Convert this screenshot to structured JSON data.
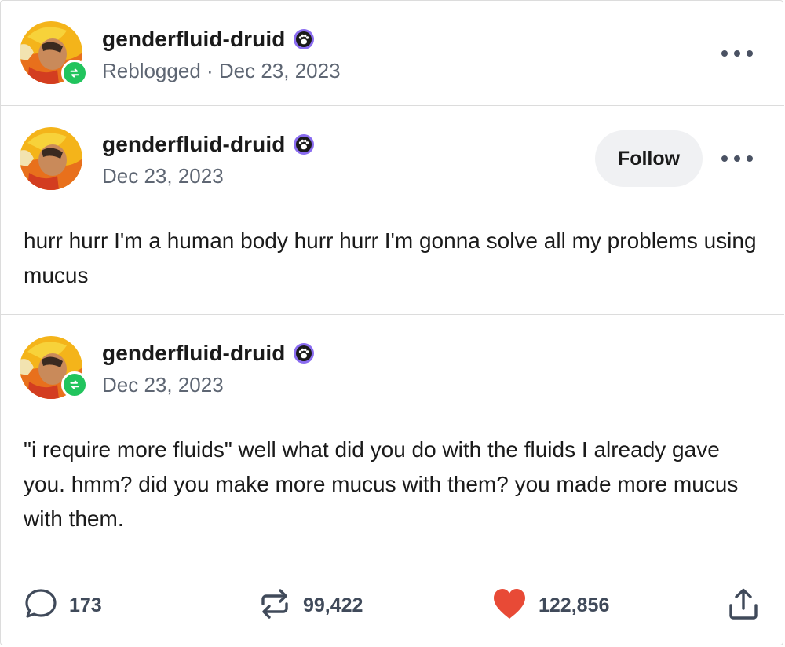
{
  "reblog_header": {
    "username": "genderfluid-druid",
    "meta": "Reblogged · Dec 23, 2023",
    "menu_icon": "more-dots-icon"
  },
  "original_post": {
    "username": "genderfluid-druid",
    "date": "Dec 23, 2023",
    "follow_label": "Follow",
    "text": "hurr hurr I'm a human body hurr hurr I'm gonna solve all my problems using mucus"
  },
  "reply_post": {
    "username": "genderfluid-druid",
    "date": "Dec 23, 2023",
    "text": "\"i require more fluids\" well what did you do with the fluids I already gave you. hmm? did you make more mucus with them? you made more mucus with them."
  },
  "actions": {
    "replies": "173",
    "reblogs": "99,422",
    "likes": "122,856"
  },
  "colors": {
    "reblog_green": "#21c45d",
    "like_red": "#e85c42",
    "paw_purple": "#8a6cf0",
    "meta_gray": "#5e6673"
  },
  "icons": [
    "reblog-badge-icon",
    "paw-badge-icon",
    "reply-icon",
    "reblog-icon",
    "heart-icon",
    "share-icon"
  ]
}
